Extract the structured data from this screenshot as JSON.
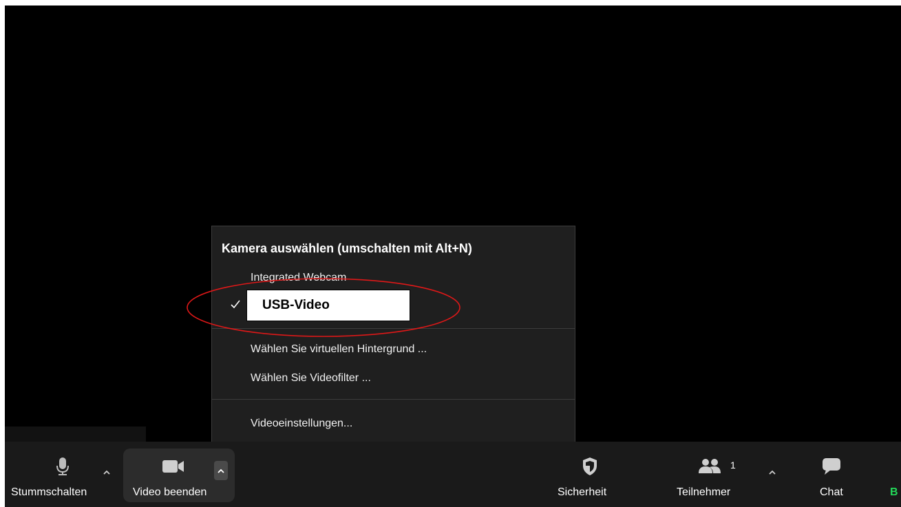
{
  "camera_menu": {
    "title": "Kamera auswählen (umschalten mit Alt+N)",
    "cameras": [
      {
        "label": "Integrated Webcam",
        "selected": false
      },
      {
        "label": "USB-Video",
        "selected": true
      }
    ],
    "background_item": "Wählen Sie virtuellen Hintergrund ...",
    "filter_item": "Wählen Sie Videofilter ...",
    "settings_item": "Videoeinstellungen..."
  },
  "toolbar": {
    "mute_label": "Stummschalten",
    "video_label": "Video beenden",
    "security_label": "Sicherheit",
    "participants_label": "Teilnehmer",
    "participants_count": "1",
    "chat_label": "Chat",
    "cut_label": "B"
  },
  "colors": {
    "accent_green": "#23d959",
    "annotation_red": "#e01818",
    "toolbar_bg": "#1a1a1a",
    "menu_bg": "#1f1f1f"
  },
  "icons": [
    "microphone-icon",
    "chevron-up-icon",
    "video-camera-icon",
    "shield-icon",
    "participants-icon",
    "chat-icon",
    "checkmark-icon"
  ]
}
